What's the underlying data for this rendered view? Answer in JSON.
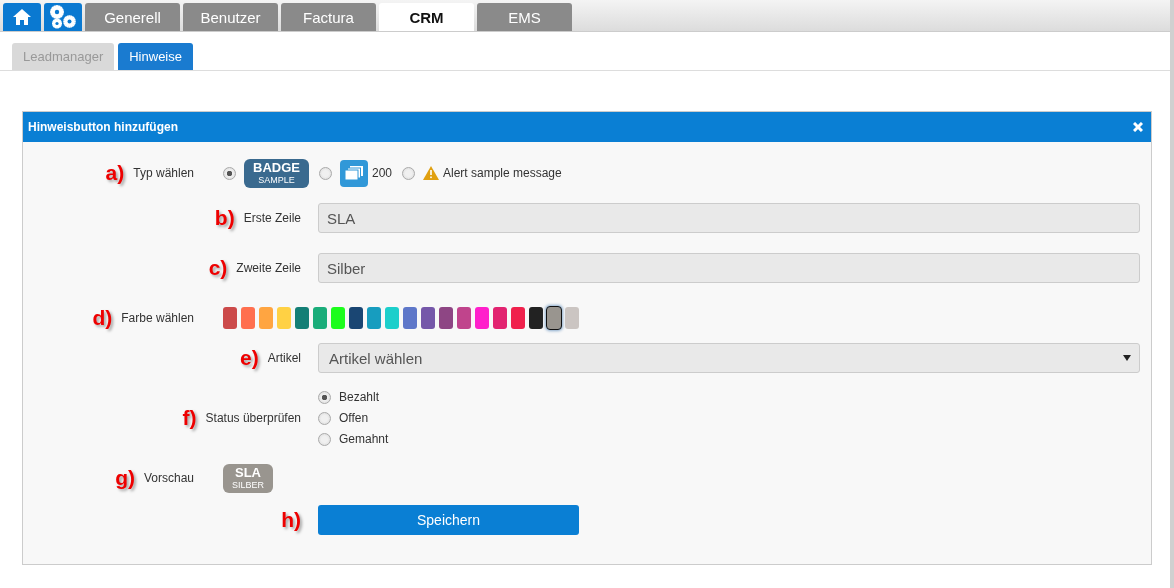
{
  "main_tabs": [
    {
      "kind": "home",
      "selected": false
    },
    {
      "kind": "settings",
      "selected": false
    },
    {
      "kind": "text",
      "label": "Generell",
      "selected": false
    },
    {
      "kind": "text",
      "label": "Benutzer",
      "selected": false
    },
    {
      "kind": "text",
      "label": "Factura",
      "selected": false
    },
    {
      "kind": "text",
      "label": "CRM",
      "selected": true
    },
    {
      "kind": "text",
      "label": "EMS",
      "selected": false
    }
  ],
  "sub_tabs": [
    {
      "label": "Leadmanager",
      "selected": false
    },
    {
      "label": "Hinweise",
      "selected": true
    }
  ],
  "panel": {
    "title": "Hinweisbutton hinzufügen",
    "rows": [
      {
        "kind": "type",
        "marker": "a)",
        "label": "Typ wählen",
        "options": [
          {
            "kind": "badge",
            "line1": "BADGE",
            "line2": "SAMPLE",
            "selected": true
          },
          {
            "kind": "counter",
            "text": "200",
            "selected": false
          },
          {
            "kind": "alert",
            "text": "Alert sample message",
            "selected": false
          }
        ]
      },
      {
        "kind": "field",
        "marker": "b)",
        "label": "Erste Zeile",
        "value": "SLA"
      },
      {
        "kind": "field",
        "marker": "c)",
        "label": "Zweite Zeile",
        "value": "Silber"
      },
      {
        "kind": "colors",
        "marker": "d)",
        "label": "Farbe wählen",
        "swatches": [
          {
            "color": "#cc4a4a",
            "selected": false
          },
          {
            "color": "#ff6f4f",
            "selected": false
          },
          {
            "color": "#ffa541",
            "selected": false
          },
          {
            "color": "#ffd144",
            "selected": false
          },
          {
            "color": "#137f76",
            "selected": false
          },
          {
            "color": "#1aad7a",
            "selected": false
          },
          {
            "color": "#1dfd1d",
            "selected": false
          },
          {
            "color": "#1a4673",
            "selected": false
          },
          {
            "color": "#179dbf",
            "selected": false
          },
          {
            "color": "#1ccfcb",
            "selected": false
          },
          {
            "color": "#5e77c9",
            "selected": false
          },
          {
            "color": "#7557a9",
            "selected": false
          },
          {
            "color": "#8e4684",
            "selected": false
          },
          {
            "color": "#c0448c",
            "selected": false
          },
          {
            "color": "#ff1fcb",
            "selected": false
          },
          {
            "color": "#e22370",
            "selected": false
          },
          {
            "color": "#f0214c",
            "selected": false
          },
          {
            "color": "#222222",
            "selected": false
          },
          {
            "color": "#99958f",
            "selected": true
          },
          {
            "color": "#cbc5c2",
            "selected": false
          }
        ]
      },
      {
        "kind": "select",
        "marker": "e)",
        "label": "Artikel",
        "value": "Artikel wählen"
      },
      {
        "kind": "radios",
        "marker": "f)",
        "label": "Status überprüfen",
        "options": [
          {
            "label": "Bezahlt",
            "selected": true
          },
          {
            "label": "Offen",
            "selected": false
          },
          {
            "label": "Gemahnt",
            "selected": false
          }
        ]
      },
      {
        "kind": "preview",
        "marker": "g)",
        "label": "Vorschau",
        "line1": "SLA",
        "line2": "SILBER",
        "color": "#99958f"
      },
      {
        "kind": "button",
        "marker": "h)",
        "label": "Speichern"
      }
    ]
  }
}
